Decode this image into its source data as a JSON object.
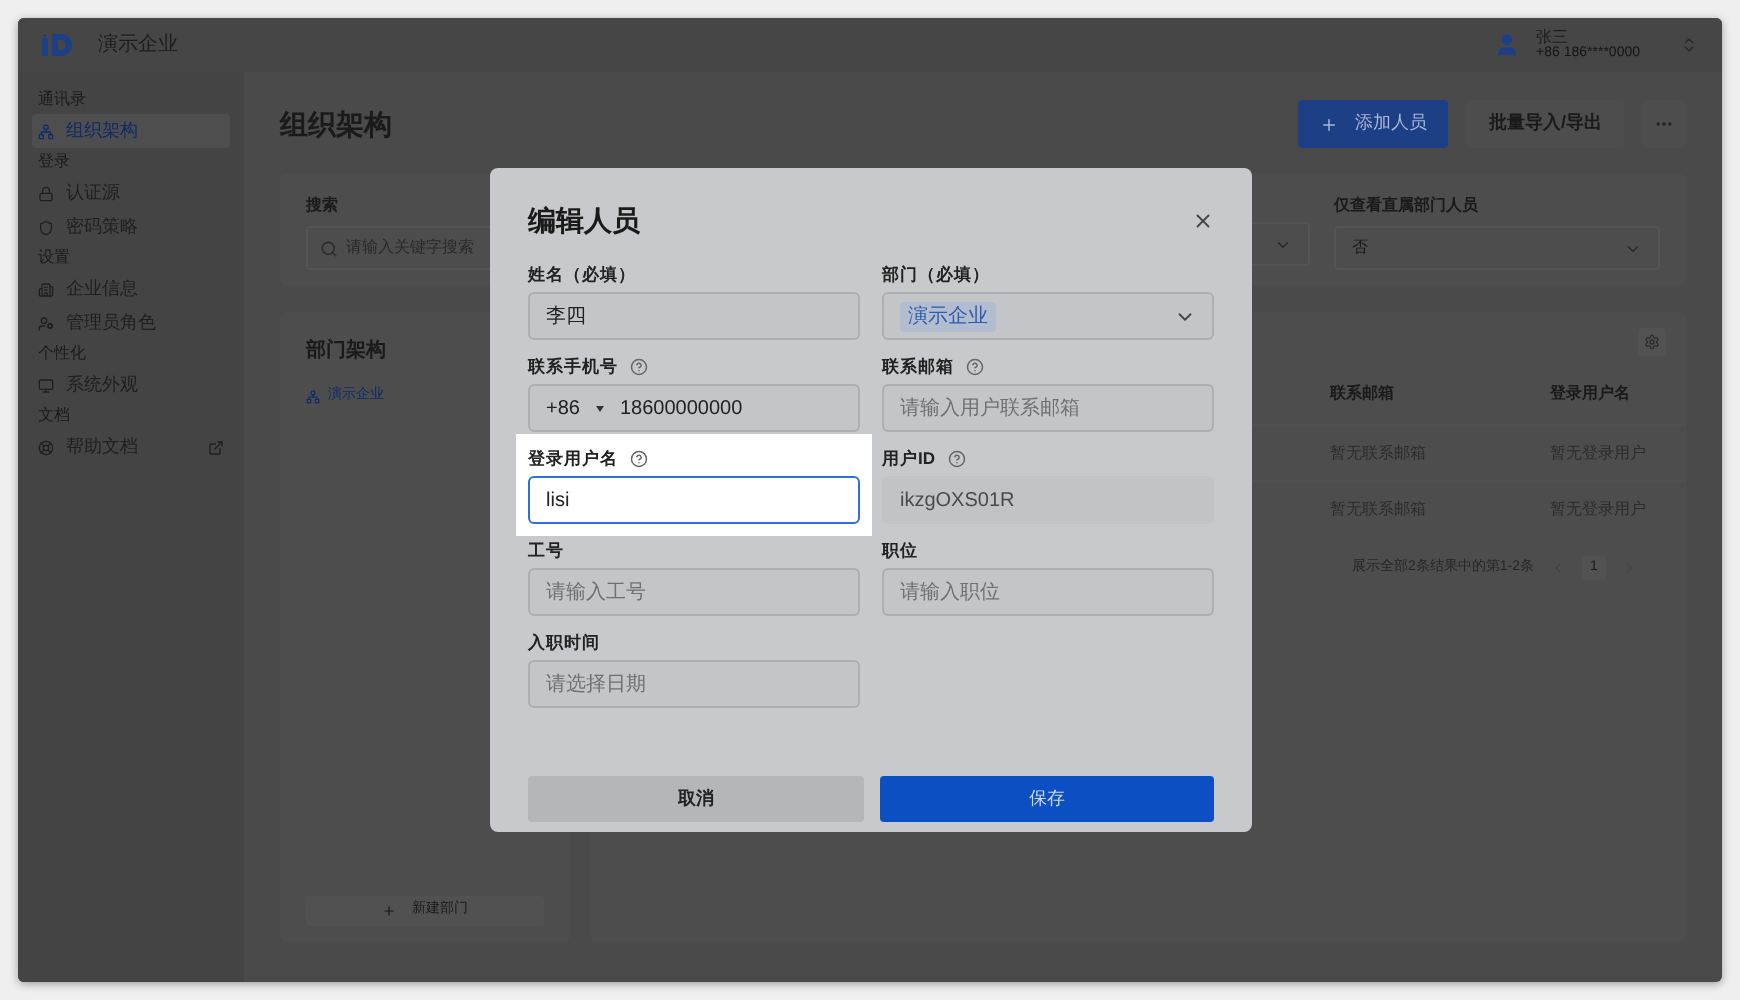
{
  "topbar": {
    "company": "演示企业",
    "user_name": "张三",
    "user_phone": "+86 186****0000"
  },
  "sidebar": [
    {
      "heading": "通讯录",
      "items": [
        {
          "label": "组织架构",
          "selected": true,
          "external": false
        }
      ]
    },
    {
      "heading": "登录",
      "items": [
        {
          "label": "认证源",
          "selected": false,
          "external": false
        },
        {
          "label": "密码策略",
          "selected": false,
          "external": false
        }
      ]
    },
    {
      "heading": "设置",
      "items": [
        {
          "label": "企业信息",
          "selected": false,
          "external": false
        },
        {
          "label": "管理员角色",
          "selected": false,
          "external": false
        }
      ]
    },
    {
      "heading": "个性化",
      "items": [
        {
          "label": "系统外观",
          "selected": false,
          "external": false
        }
      ]
    },
    {
      "heading": "文档",
      "items": [
        {
          "label": "帮助文档",
          "selected": false,
          "external": true
        }
      ]
    }
  ],
  "page": {
    "title": "组织架构",
    "add_button": "添加人员",
    "import_button": "批量导入/导出"
  },
  "filters": {
    "search_label": "搜索",
    "search_placeholder": "请输入关键字搜索",
    "direct_label": "仅查看直属部门人员",
    "direct_value": "否"
  },
  "departments": {
    "title": "部门架构",
    "tree": [
      {
        "label": "演示企业",
        "selected": true
      }
    ],
    "new_button": "新建部门"
  },
  "table": {
    "columns": [
      "联系邮箱",
      "登录用户名"
    ],
    "rows": [
      [
        "暂无联系邮箱",
        "暂无登录用户"
      ],
      [
        "暂无联系邮箱",
        "暂无登录用户"
      ]
    ],
    "summary": "展示全部2条结果中的第1-2条",
    "pages": [
      {
        "label": "1",
        "selected": true
      }
    ]
  },
  "modal": {
    "title": "编辑人员",
    "fields": [
      {
        "label": "姓名（必填）",
        "kind": "text",
        "help": false,
        "focused": false,
        "disabled": false,
        "value": "李四"
      },
      {
        "label": "部门（必填）",
        "kind": "select",
        "help": false,
        "focused": false,
        "disabled": false,
        "value": "演示企业"
      },
      {
        "label": "联系手机号",
        "kind": "phone",
        "help": true,
        "focused": false,
        "disabled": false,
        "code": "+86",
        "value": "18600000000"
      },
      {
        "label": "联系邮箱",
        "kind": "text",
        "help": true,
        "focused": false,
        "disabled": false,
        "placeholder": "请输入用户联系邮箱"
      },
      {
        "label": "登录用户名",
        "kind": "text",
        "help": true,
        "focused": true,
        "disabled": false,
        "value": "lisi"
      },
      {
        "label": "用户ID",
        "kind": "text",
        "help": true,
        "focused": false,
        "disabled": true,
        "value": "ikzgOXS01R"
      },
      {
        "label": "工号",
        "kind": "text",
        "help": false,
        "focused": false,
        "disabled": false,
        "placeholder": "请输入工号"
      },
      {
        "label": "职位",
        "kind": "text",
        "help": false,
        "focused": false,
        "disabled": false,
        "placeholder": "请输入职位"
      },
      {
        "label": "入职时间",
        "kind": "text",
        "help": false,
        "focused": false,
        "disabled": false,
        "placeholder": "请选择日期"
      }
    ],
    "cancel": "取消",
    "save": "保存"
  }
}
